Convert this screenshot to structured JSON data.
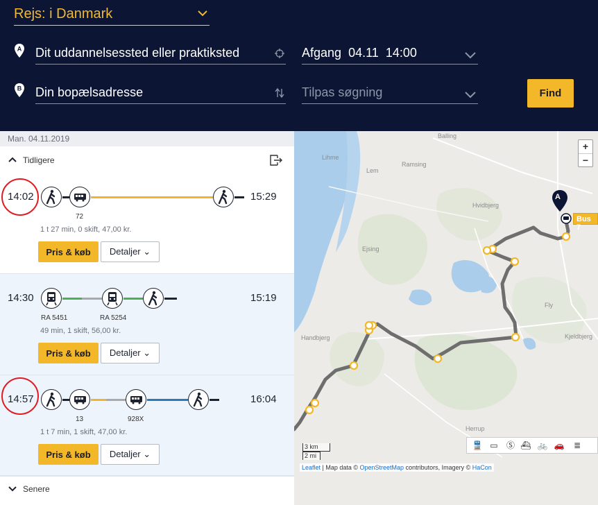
{
  "header": {
    "rejs_label": "Rejs: i Danmark",
    "from_placeholder": "Dit uddannelsessted eller praktiksted",
    "to_placeholder": "Din bopælsadresse",
    "depart": "Afgang",
    "depart_date": "04.11",
    "depart_time": "14:00",
    "adjust_search": "Tilpas søgning",
    "find_label": "Find",
    "pin_a": "A",
    "pin_b": "B"
  },
  "results": {
    "date": "Man. 04.11.2019",
    "earlier_label": "Tidligere",
    "later_label": "Senere",
    "price_button": "Pris & køb",
    "detail_button": "Detaljer",
    "trips": [
      {
        "depart": "14:02",
        "arrive": "15:29",
        "meta": "1 t 27 min, 0 skift, 47,00 kr.",
        "line_labels": [
          "72"
        ],
        "line_color": "#f3b32c",
        "highlighted": true
      },
      {
        "depart": "14:30",
        "arrive": "15:19",
        "meta": "49 min, 1 skift, 56,00 kr.",
        "line_labels": [
          "RA 5451",
          "RA 5254"
        ],
        "line_colors": [
          "#4caf50",
          "#a7a9ad",
          "#4caf50"
        ],
        "highlighted": false
      },
      {
        "depart": "14:57",
        "arrive": "16:04",
        "meta": "1 t 7 min, 1 skift, 47,00 kr.",
        "line_labels": [
          "13",
          "928X"
        ],
        "line_colors": [
          "#f3b32c",
          "#a7a9ad",
          "#2a7ab8"
        ],
        "highlighted": true
      }
    ]
  },
  "map": {
    "towns": [
      "Balling",
      "Lihme",
      "Lem",
      "Ramsing",
      "Hvidbjerg",
      "Ejsing",
      "Fly",
      "Handbjerg",
      "Kjeldbjerg",
      "Herrup"
    ],
    "bus_label": "Bus 7",
    "marker_a": "A",
    "scale_km": "3 km",
    "scale_mi": "2 mi",
    "attrib_leaflet": "Leaflet",
    "attrib_text_1": " | Map data © ",
    "attrib_osm": "OpenStreetMap",
    "attrib_text_2": " contributors, Imagery © ",
    "attrib_hacon": "HaCon",
    "zoom_in": "+",
    "zoom_out": "−"
  },
  "colors": {
    "header_bg": "#0c1634",
    "accent": "#f3b82a",
    "highlight_ring": "#e01b22",
    "route": "#6e6e6e"
  }
}
